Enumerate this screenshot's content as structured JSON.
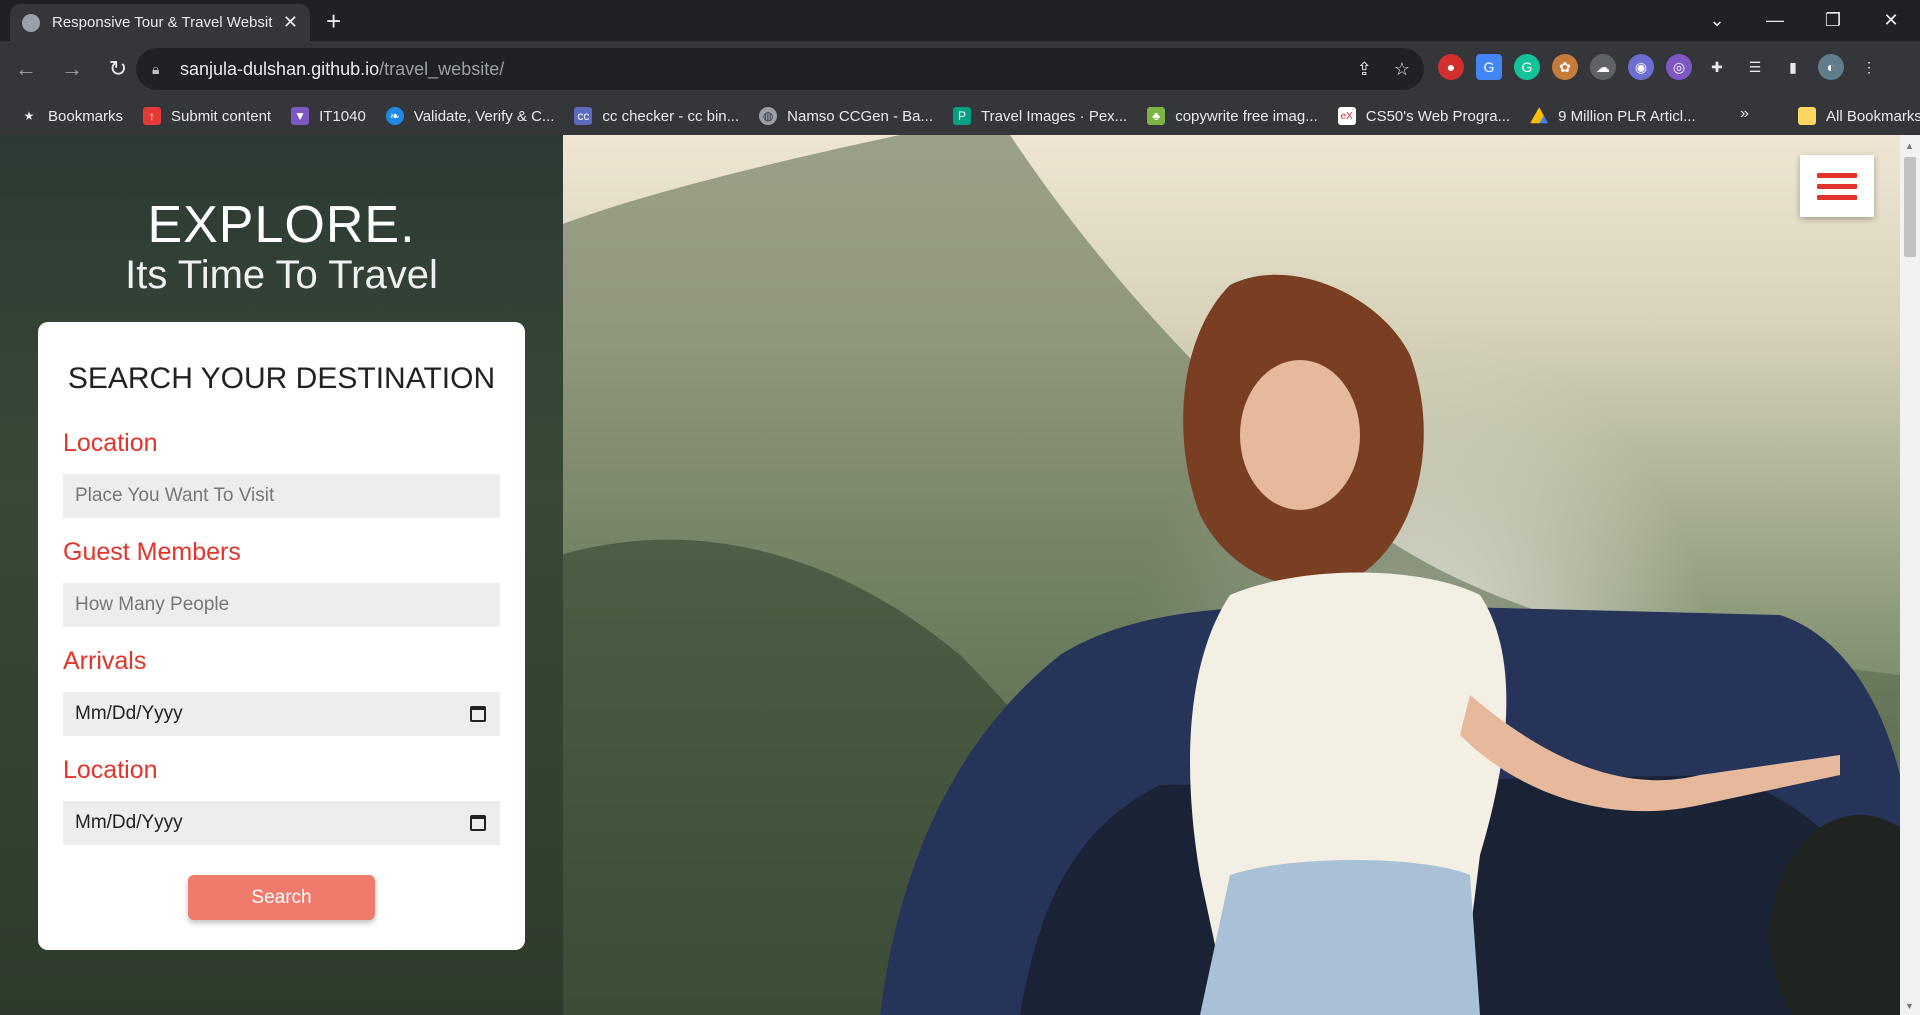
{
  "browser": {
    "tab_title": "Responsive Tour & Travel Websit",
    "url_host": "sanjula-dulshan.github.io",
    "url_path": "/travel_website/",
    "bookmarks": [
      {
        "label": "Bookmarks",
        "icon": "star-icon",
        "color": "#e8eaed"
      },
      {
        "label": "Submit content",
        "icon": "submit-icon",
        "color": "#e53935"
      },
      {
        "label": "IT1040",
        "icon": "shield-crest-icon",
        "color": "#7e57c2"
      },
      {
        "label": "Validate, Verify & C...",
        "icon": "leaf-icon",
        "color": "#1e88e5"
      },
      {
        "label": "cc checker - cc bin...",
        "icon": "cc-icon",
        "color": "#5c6bc0"
      },
      {
        "label": "Namso CCGen - Ba...",
        "icon": "globe-icon",
        "color": "#9aa0a6"
      },
      {
        "label": "Travel Images · Pex...",
        "icon": "pexels-icon",
        "color": "#05a081"
      },
      {
        "label": "copywrite free imag...",
        "icon": "pixabay-icon",
        "color": "#7cb342"
      },
      {
        "label": "CS50's Web Progra...",
        "icon": "edx-icon",
        "color": "#d32f2f"
      },
      {
        "label": "9 Million PLR Articl...",
        "icon": "google-drive-icon",
        "color": "#fbbc04"
      }
    ],
    "more_label": "»",
    "all_bookmarks_label": "All Bookmarks"
  },
  "hero": {
    "headline": "EXPLORE.",
    "subline": "Its Time To Travel"
  },
  "search_form": {
    "title": "SEARCH YOUR DESTINATION",
    "location_label": "Location",
    "location_placeholder": "Place You Want To Visit",
    "guests_label": "Guest Members",
    "guests_placeholder": "How Many People",
    "arrivals_label": "Arrivals",
    "arrivals_value": "Mm/Dd/Yyyy",
    "leaving_label": "Location",
    "leaving_value": "Mm/Dd/Yyyy",
    "search_button": "Search"
  },
  "colors": {
    "accent": "#e2342a",
    "button": "#f07a6c"
  }
}
